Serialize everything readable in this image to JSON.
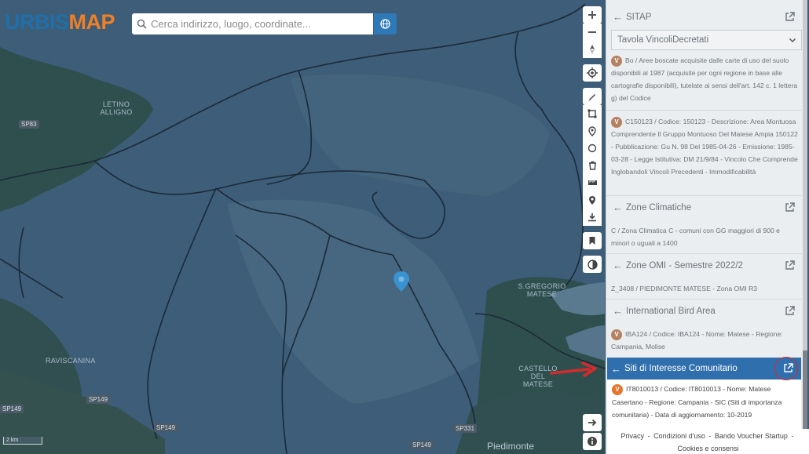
{
  "app": {
    "logo_part1": "URBIS",
    "logo_part2": "MAP"
  },
  "search": {
    "placeholder": "Cerca indirizzo, luogo, coordinate..."
  },
  "map": {
    "road_labels": [
      "SP83",
      "SP149",
      "SP149",
      "SP149",
      "SP149",
      "SP331"
    ],
    "place_labels": [
      "RAVISCANINA",
      "S.GREGORIO MATESE",
      "CASTELLO DEL MATESE",
      "LETINO ALLIGNO"
    ],
    "town_label": "Piedimonte",
    "scale_label": "2 km"
  },
  "panel": {
    "sitap": {
      "title": "SITAP",
      "select_value": "Tavola VincoliDecretati",
      "item1": "Bo / Aree boscate acquisite dalle carte di uso del suolo disponibili al 1987 (acquisite per ogni regione in base alle cartografie disponibili), tutelate ai sensi dell'art. 142 c. 1 lettera g) del Codice",
      "item2": "C150123 / Codice: 150123 - Descrizione: Area Montuosa Comprendente Il Gruppo Montuoso Del Matese Ampia 150122 - Pubblicazione: Gu N. 98 Del 1985-04-26 - Emissione: 1985-03-28 - Legge Istitutiva: DM 21/9/84 - Vincolo Che Comprende Inglobandoli Vincoli Precedenti - Immodificabilità"
    },
    "zone_climatiche": {
      "title": "Zone Climatiche",
      "text": "C / Zona Climatica C - comuni con GG maggiori di 900 e minori o uguali a 1400"
    },
    "zone_omi": {
      "title": "Zone OMI - Semestre 2022/2",
      "text": "Z_3408 / PIEDIMONTE MATESE - Zona OMI R3"
    },
    "iba": {
      "title": "International Bird Area",
      "text": "IBA124 / Codice: IBA124 - Nome: Matese - Regione: Campania, Molise"
    },
    "sic": {
      "title": "Siti di Interesse Comunitario",
      "text": "IT8010013 / Codice: IT8010013 - Nome: Matese Casertano - Regione: Campania - SIC (Siti di importanza comunitaria) - Data di aggiornamento: 10-2019"
    },
    "badge_letter": "V"
  },
  "footer": {
    "privacy": "Privacy",
    "conditions": "Condizioni d'uso",
    "voucher": "Bando Voucher Startup",
    "cookies": "Cookies e consensi",
    "sep": "-"
  },
  "colors": {
    "brand_blue": "#1f6fa8",
    "brand_orange": "#f07f25",
    "active_header": "#2f6fae",
    "annotation_red": "#d62b2b"
  }
}
